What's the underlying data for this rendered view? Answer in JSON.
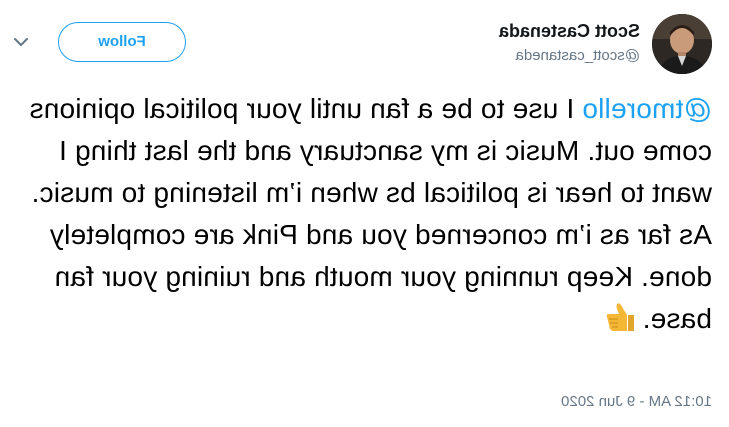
{
  "tweet": {
    "author": {
      "name": "Scott Castenada",
      "handle": "@scott_castaneda"
    },
    "follow_label": "Follow",
    "mention": "@tmorello",
    "text": " I use to be a fan until your political opinions come out. Music is my sanctuary and the last thing I want to hear is political bs when i’m listening to music. As far as i’m concerned you and Pink are completely done. Keep running your mouth and ruining your fan base.",
    "emoji": "thumbs-up",
    "timestamp": "10:12 AM - 9 Jun 2020"
  },
  "colors": {
    "accent": "#1da1f2",
    "secondary_text": "#657786",
    "emoji_fill": "#f5b836"
  },
  "icons": {
    "menu": "chevron-down-icon",
    "avatar": "profile-photo"
  }
}
